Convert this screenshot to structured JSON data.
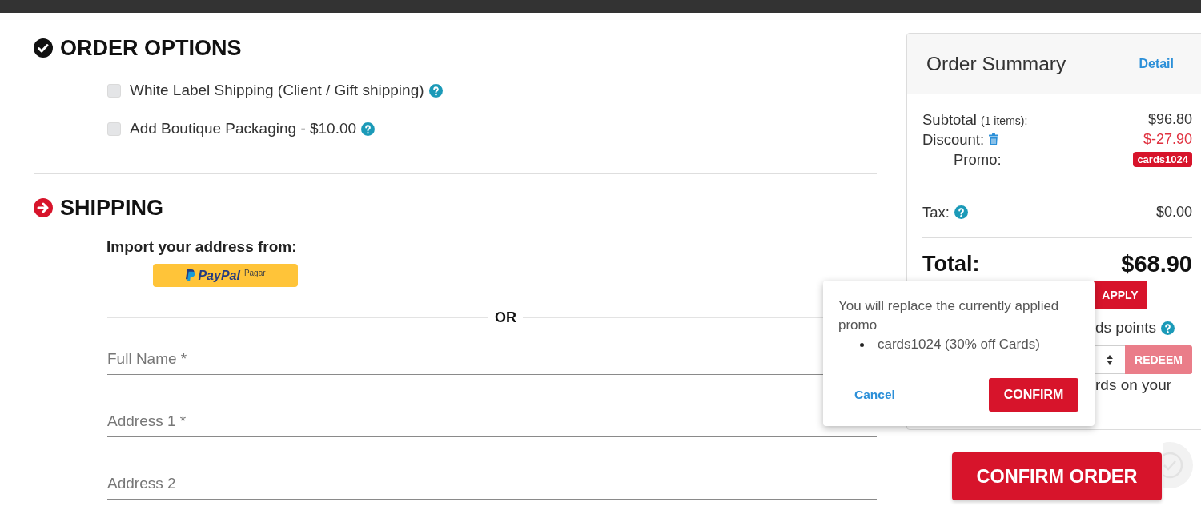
{
  "order_options": {
    "title": "ORDER OPTIONS",
    "completed": true,
    "options": [
      {
        "label": "White Label Shipping (Client / Gift shipping)",
        "checked": false
      },
      {
        "label": "Add Boutique Packaging - $10.00",
        "checked": false
      }
    ]
  },
  "shipping": {
    "title": "SHIPPING",
    "completed": false,
    "import_label": "Import your address from:",
    "paypal_button": {
      "brand": "PayPal",
      "label": "Pagar"
    },
    "divider_label": "OR",
    "fields": [
      {
        "placeholder": "Full Name *"
      },
      {
        "placeholder": "Address 1 *"
      },
      {
        "placeholder": "Address 2"
      }
    ]
  },
  "order_summary": {
    "title": "Order Summary",
    "detail_link": "Detail",
    "lines": [
      {
        "kind": "subtotal",
        "label": "Subtotal",
        "note": "(1 items):",
        "value": "$96.80"
      },
      {
        "kind": "discount",
        "label": "Discount:",
        "value": "$-27.90"
      },
      {
        "kind": "promo",
        "label": "Promo:",
        "badge": "cards1024"
      },
      {
        "kind": "tax",
        "label": "Tax:",
        "value": "$0.00"
      }
    ],
    "total": {
      "label": "Total:",
      "value": "$68.90"
    },
    "apply_button": "APPLY",
    "points_label": "ds points",
    "redeem_button": {
      "label": "REDEEM",
      "disabled": true
    },
    "points_note": "rds on your"
  },
  "promo_popover": {
    "message": "You will replace the currently applied promo",
    "items": [
      "cards1024 (30% off Cards)"
    ],
    "cancel_link": "Cancel",
    "confirm_button": "CONFIRM"
  },
  "confirm_order_button": "CONFIRM ORDER"
}
